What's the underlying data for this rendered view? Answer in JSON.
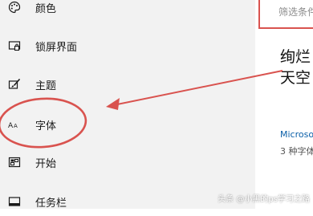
{
  "sidebar": {
    "items": [
      {
        "label": "颜色",
        "icon": "palette-icon"
      },
      {
        "label": "锁屏界面",
        "icon": "lock-screen-icon"
      },
      {
        "label": "主题",
        "icon": "theme-brush-icon"
      },
      {
        "label": "字体",
        "icon": "font-icon"
      },
      {
        "label": "开始",
        "icon": "start-menu-icon"
      },
      {
        "label": "任务栏",
        "icon": "taskbar-icon"
      }
    ]
  },
  "content": {
    "filter_placeholder": "筛选条件",
    "font_preview": {
      "line1": "绚烂",
      "line2": "天空"
    },
    "font_name": "Microsoft",
    "font_count": "3 种字体"
  },
  "annotation": {
    "color": "#d9534f"
  },
  "watermark": "头条 @小黑的ps学习之路"
}
